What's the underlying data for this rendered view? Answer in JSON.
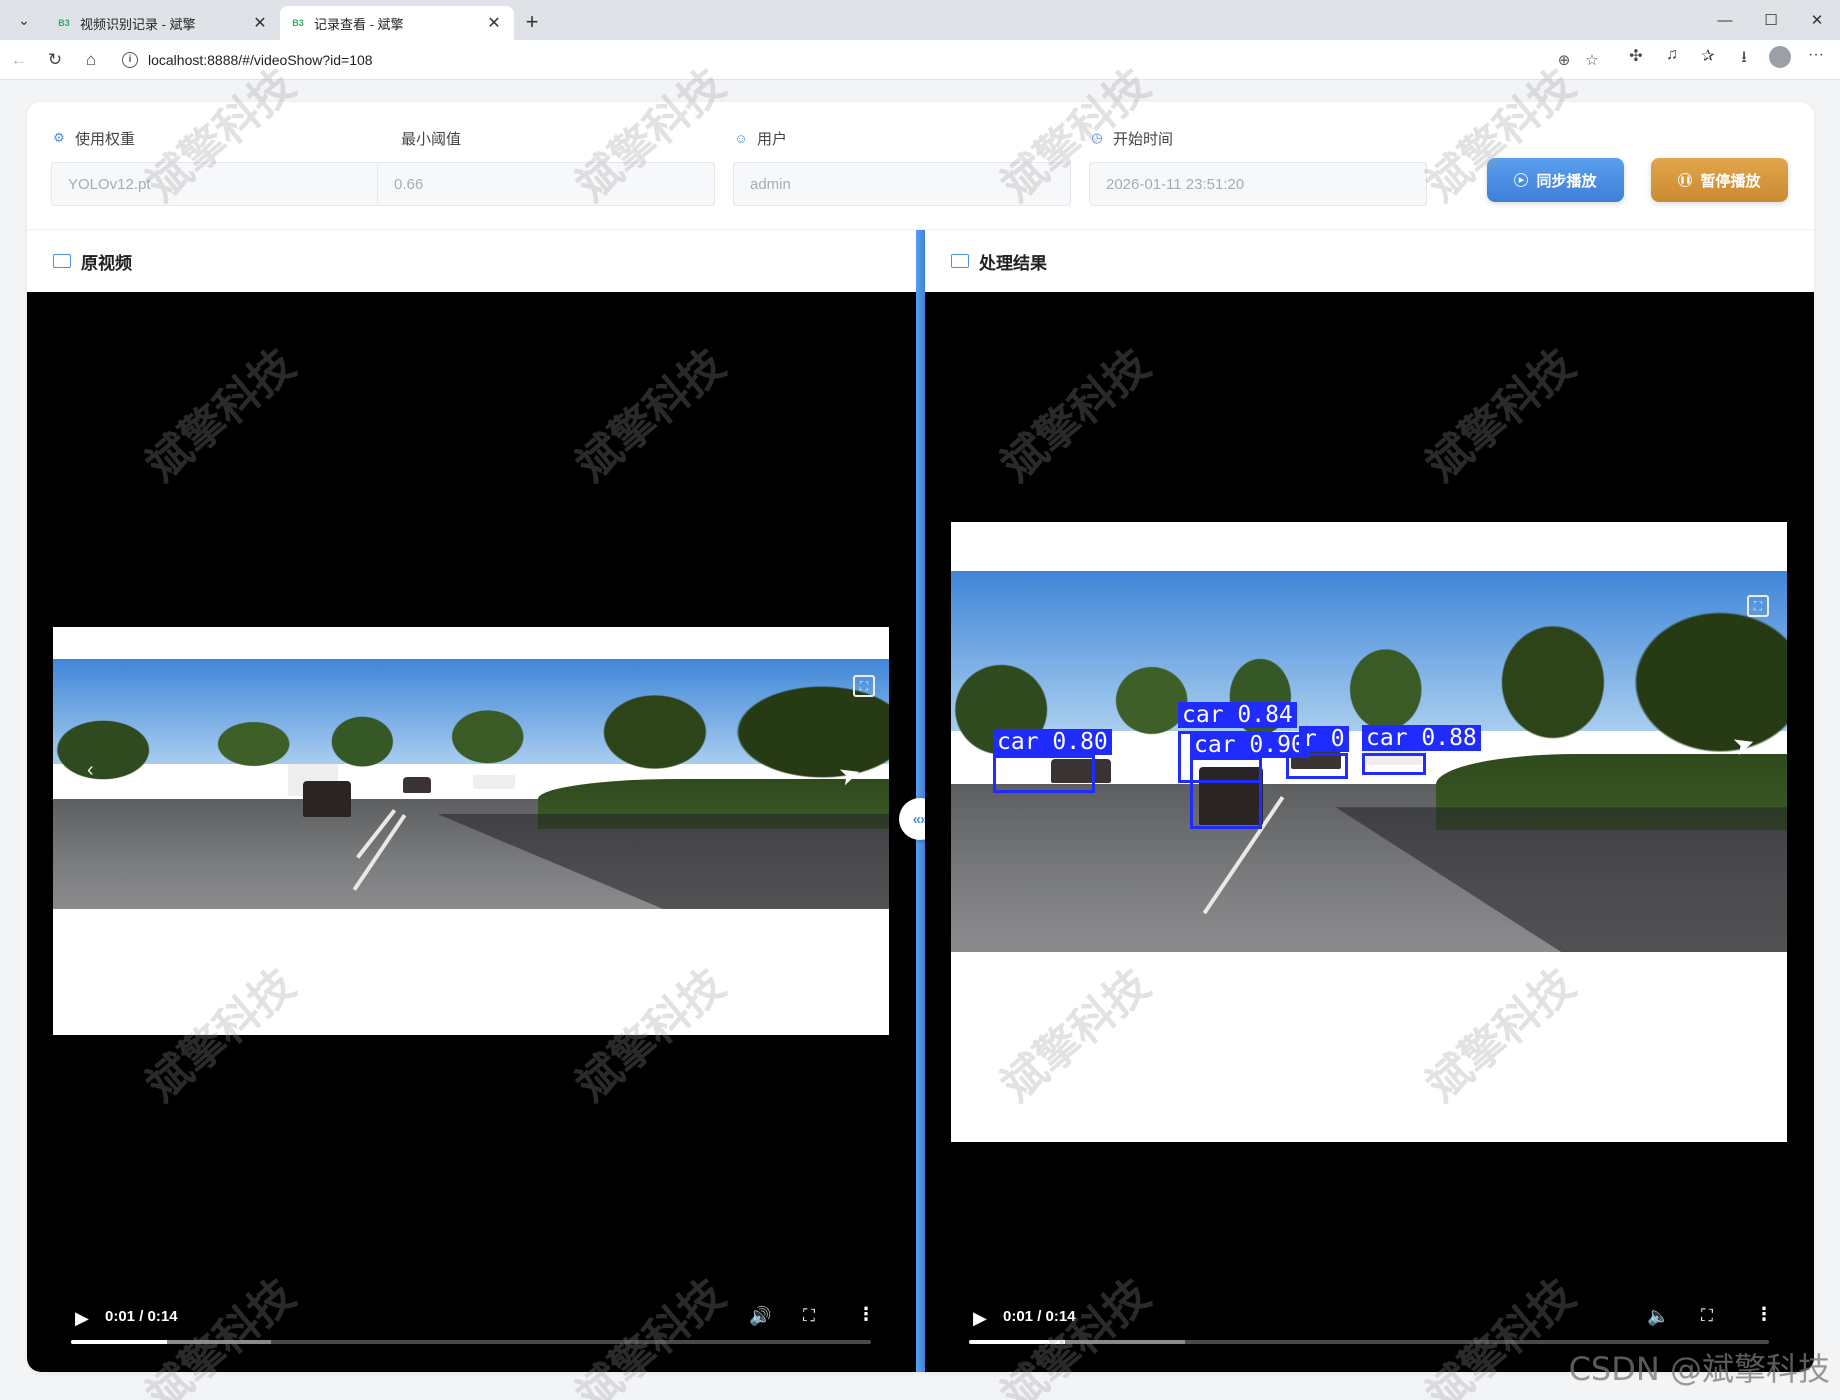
{
  "browser": {
    "tabs": [
      {
        "favicon": "B3",
        "title": "视频识别记录 - 斌擎",
        "active": false
      },
      {
        "favicon": "B3",
        "title": "记录查看 - 斌擎",
        "active": true
      }
    ],
    "url": "localhost:8888/#/videoShow?id=108"
  },
  "form": {
    "weight_label": "使用权重",
    "weight_value": "YOLOv12.pt",
    "threshold_label": "最小阈值",
    "threshold_value": "0.66",
    "user_label": "用户",
    "user_value": "admin",
    "start_label": "开始时间",
    "start_value": "2026-01-11 23:51:20",
    "sync_button": "同步播放",
    "pause_button": "暂停播放"
  },
  "panels": {
    "original_title": "原视频",
    "result_title": "处理结果"
  },
  "video_left": {
    "time": "0:01 / 0:14",
    "progress": 0.12,
    "buffered": 0.25
  },
  "video_right": {
    "time": "0:01 / 0:14",
    "progress": 0.12,
    "buffered": 0.27
  },
  "detections": [
    {
      "label": "car 0.80"
    },
    {
      "label": "car 0.84"
    },
    {
      "label": "car 0.90"
    },
    {
      "label": "r 0"
    },
    {
      "label": "car 0.88"
    }
  ],
  "watermark_text": "斌擎科技",
  "footer_watermark": "CSDN @斌擎科技",
  "colors": {
    "accent": "#4a8fe0",
    "sync": "#4a8fe0",
    "pause": "#d4973c",
    "bbox": "#1f2bff"
  }
}
